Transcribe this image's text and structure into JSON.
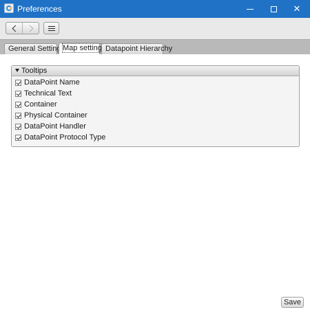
{
  "window": {
    "title": "Preferences",
    "controls": {
      "minimize_icon": "minimize-icon",
      "maximize_icon": "maximize-icon",
      "close_glyph": "✕"
    }
  },
  "toolbar": {
    "back_icon": "chevron-left-icon",
    "forward_icon": "chevron-right-icon",
    "grid_icon": "grid-icon"
  },
  "tabs": [
    {
      "label": "General Settings",
      "selected": false
    },
    {
      "label": "Map settings",
      "selected": true
    },
    {
      "label": "Datapoint Hierarchy",
      "selected": false
    }
  ],
  "tooltips": {
    "title": "Tooltips",
    "expanded": true,
    "items": [
      {
        "label": "DataPoint Name",
        "checked": true
      },
      {
        "label": "Technical Text",
        "checked": true
      },
      {
        "label": "Container",
        "checked": true
      },
      {
        "label": "Physical Container",
        "checked": true
      },
      {
        "label": "DataPoint Handler",
        "checked": true
      },
      {
        "label": "DataPoint Protocol Type",
        "checked": true
      }
    ]
  },
  "footer": {
    "save_label": "Save"
  },
  "colors": {
    "titlebar": "#1f72c6",
    "tabbar": "#b9b9b9",
    "toolbar": "#e9e9e9"
  }
}
